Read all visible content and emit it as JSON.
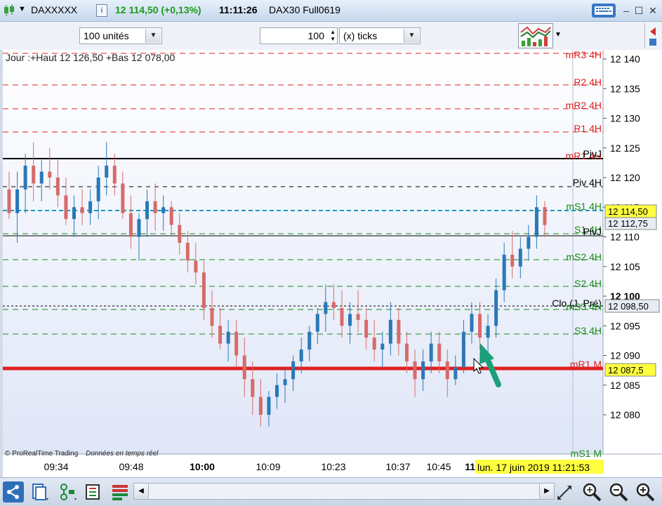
{
  "titlebar": {
    "instrument": "DAXXXXX",
    "info_icon": "info-icon",
    "price_change": "12 114,50 (+0,13%)",
    "time": "11:11:26",
    "contract": "DAX30 Full0619"
  },
  "toolbar": {
    "units_select": "100 unités",
    "ticks_value": "100",
    "ticks_select": "(x) ticks"
  },
  "chart": {
    "header": "Jour :+Haut 12 126,50 +Bas 12 078,00",
    "watermark_brand": "© ProRealTime Trading",
    "watermark_note": "Données en temps réel",
    "price_axis_labels": [
      "12 140",
      "12 135",
      "12 130",
      "12 125",
      "12 120",
      "12 115",
      "12 110",
      "12 105",
      "12 100",
      "12 095",
      "12 090",
      "12 085",
      "12 080"
    ],
    "time_axis_labels": [
      "09:34",
      "09:48",
      "10:00",
      "10:09",
      "10:23",
      "10:37",
      "10:45",
      "11:"
    ],
    "cursor_datetime": "lun. 17 juin 2019 11:21:53",
    "level_labels": [
      {
        "text": "mR3 4H",
        "color": "#e02020"
      },
      {
        "text": "R2 4H",
        "color": "#e02020"
      },
      {
        "text": "mR2 4H",
        "color": "#e02020"
      },
      {
        "text": "R1 4H",
        "color": "#e02020"
      },
      {
        "text": "mR1 4H",
        "color": "#e02020"
      },
      {
        "text": "PivJ",
        "color": "#000000"
      },
      {
        "text": "Piv 4H",
        "color": "#000000"
      },
      {
        "text": "mS1 4H",
        "color": "#1a8a1a"
      },
      {
        "text": "S1 4H",
        "color": "#1a8a1a"
      },
      {
        "text": "PivJ",
        "color": "#000000"
      },
      {
        "text": "mS2 4H",
        "color": "#1a8a1a"
      },
      {
        "text": "S2 4H",
        "color": "#1a8a1a"
      },
      {
        "text": "Clo (J. Pré)",
        "color": "#000000"
      },
      {
        "text": "mS3 4H",
        "color": "#1a8a1a"
      },
      {
        "text": "S3 4H",
        "color": "#1a8a1a"
      },
      {
        "text": "mR1 M",
        "color": "#e02020"
      },
      {
        "text": "mS1 M",
        "color": "#1a8a1a"
      }
    ],
    "price_tags": {
      "last": "12 114,50",
      "cursor": "12 112,75",
      "prev_close": "12 098,50",
      "mr1m": "12 087,5",
      "bold_level": "12 100"
    },
    "colors": {
      "up_candle": "#2a78b8",
      "down_candle": "#d86a6a",
      "resistance": "#e02020",
      "support": "#1a8a1a",
      "arrow": "#1b9e7a",
      "last_price_tag": "#ffff40"
    }
  },
  "chart_data": {
    "type": "candlestick",
    "ylim": [
      12077,
      12141
    ],
    "ohlc": [
      [
        12118,
        12121,
        12113,
        12114
      ],
      [
        12114,
        12121,
        12109,
        12118
      ],
      [
        12118,
        12124,
        12114,
        12122
      ],
      [
        12122,
        12126,
        12116,
        12119
      ],
      [
        12119,
        12123,
        12116,
        12121
      ],
      [
        12121,
        12125,
        12118,
        12120
      ],
      [
        12120,
        12123,
        12115,
        12117
      ],
      [
        12117,
        12120,
        12112,
        12113
      ],
      [
        12113,
        12117,
        12110,
        12115
      ],
      [
        12115,
        12118,
        12112,
        12114
      ],
      [
        12114,
        12118,
        12112,
        12116
      ],
      [
        12116,
        12122,
        12113,
        12120
      ],
      [
        12120,
        12126,
        12117,
        12122
      ],
      [
        12122,
        12124,
        12117,
        12119
      ],
      [
        12119,
        12121,
        12113,
        12114
      ],
      [
        12114,
        12117,
        12108,
        12110
      ],
      [
        12110,
        12114,
        12106,
        12113
      ],
      [
        12113,
        12118,
        12110,
        12116
      ],
      [
        12116,
        12119,
        12111,
        12114
      ],
      [
        12114,
        12117,
        12111,
        12115
      ],
      [
        12115,
        12116,
        12110,
        12112
      ],
      [
        12112,
        12114,
        12107,
        12109
      ],
      [
        12109,
        12111,
        12104,
        12106
      ],
      [
        12106,
        12109,
        12102,
        12104
      ],
      [
        12104,
        12106,
        12096,
        12098
      ],
      [
        12098,
        12101,
        12093,
        12095
      ],
      [
        12095,
        12098,
        12091,
        12092
      ],
      [
        12092,
        12096,
        12089,
        12094
      ],
      [
        12094,
        12096,
        12088,
        12090
      ],
      [
        12090,
        12093,
        12083,
        12086
      ],
      [
        12086,
        12089,
        12080,
        12083
      ],
      [
        12083,
        12086,
        12078,
        12080
      ],
      [
        12080,
        12084,
        12078,
        12083
      ],
      [
        12083,
        12087,
        12081,
        12085
      ],
      [
        12085,
        12088,
        12082,
        12086
      ],
      [
        12086,
        12090,
        12084,
        12089
      ],
      [
        12089,
        12093,
        12087,
        12091
      ],
      [
        12091,
        12095,
        12089,
        12094
      ],
      [
        12094,
        12098,
        12092,
        12097
      ],
      [
        12097,
        12102,
        12094,
        12099
      ],
      [
        12099,
        12102,
        12096,
        12098
      ],
      [
        12098,
        12101,
        12093,
        12095
      ],
      [
        12095,
        12099,
        12092,
        12097
      ],
      [
        12097,
        12101,
        12094,
        12096
      ],
      [
        12096,
        12098,
        12091,
        12093
      ],
      [
        12093,
        12096,
        12089,
        12091
      ],
      [
        12091,
        12094,
        12088,
        12092
      ],
      [
        12092,
        12099,
        12090,
        12096
      ],
      [
        12096,
        12098,
        12090,
        12092
      ],
      [
        12092,
        12094,
        12087,
        12089
      ],
      [
        12089,
        12091,
        12083,
        12086
      ],
      [
        12086,
        12091,
        12084,
        12089
      ],
      [
        12089,
        12094,
        12087,
        12092
      ],
      [
        12092,
        12094,
        12087,
        12089
      ],
      [
        12089,
        12091,
        12083,
        12086
      ],
      [
        12086,
        12090,
        12085,
        12088
      ],
      [
        12088,
        12096,
        12087,
        12094
      ],
      [
        12094,
        12099,
        12092,
        12097
      ],
      [
        12097,
        12099,
        12091,
        12093
      ],
      [
        12093,
        12097,
        12090,
        12095
      ],
      [
        12095,
        12103,
        12093,
        12101
      ],
      [
        12101,
        12109,
        12099,
        12107
      ],
      [
        12107,
        12111,
        12103,
        12105
      ],
      [
        12105,
        12110,
        12103,
        12108
      ],
      [
        12108,
        12112,
        12106,
        12110
      ],
      [
        12110,
        12117,
        12108,
        12115
      ],
      [
        12115,
        12116,
        12110,
        12112
      ]
    ]
  }
}
